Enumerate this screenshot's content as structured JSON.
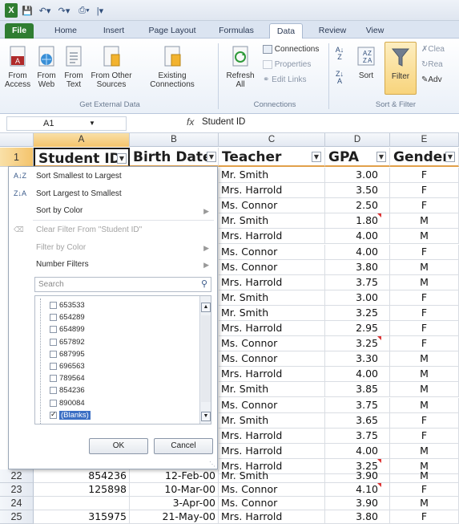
{
  "namebox": {
    "value": "A1"
  },
  "formula_bar": {
    "fx": "fx",
    "content": "Student ID"
  },
  "tabs": [
    "File",
    "Home",
    "Insert",
    "Page Layout",
    "Formulas",
    "Data",
    "Review",
    "View"
  ],
  "ribbon": {
    "from_access": "From\nAccess",
    "from_web": "From\nWeb",
    "from_text": "From\nText",
    "from_other": "From Other\nSources",
    "existing": "Existing\nConnections",
    "group_external": "Get External Data",
    "refresh": "Refresh\nAll",
    "connections": "Connections",
    "properties": "Properties",
    "edit_links": "Edit Links",
    "group_connections": "Connections",
    "sort": "Sort",
    "filter": "Filter",
    "clear": "Clea",
    "reapply": "Rea",
    "advanced": "Adv",
    "group_sort": "Sort & Filter"
  },
  "columns": [
    "A",
    "B",
    "C",
    "D",
    "E"
  ],
  "header_row": {
    "row": "1",
    "a": "Student ID",
    "b": "Birth Date",
    "c": "Teacher",
    "d": "GPA",
    "e": "Gender"
  },
  "visible_right_rows": [
    {
      "teacher": "Mr. Smith",
      "gpa": "3.00",
      "gender": "F"
    },
    {
      "teacher": "Mrs. Harrold",
      "gpa": "3.50",
      "gender": "F"
    },
    {
      "teacher": "Ms. Connor",
      "gpa": "2.50",
      "gender": "F"
    },
    {
      "teacher": "Mr. Smith",
      "gpa": "1.80",
      "gender": "M"
    },
    {
      "teacher": "Mrs. Harrold",
      "gpa": "4.00",
      "gender": "M"
    },
    {
      "teacher": "Ms. Connor",
      "gpa": "4.00",
      "gender": "F"
    },
    {
      "teacher": "Ms. Connor",
      "gpa": "3.80",
      "gender": "M"
    },
    {
      "teacher": "Mrs. Harrold",
      "gpa": "3.75",
      "gender": "M"
    },
    {
      "teacher": "Mr. Smith",
      "gpa": "3.00",
      "gender": "F"
    },
    {
      "teacher": "Mr. Smith",
      "gpa": "3.25",
      "gender": "F"
    },
    {
      "teacher": "Mrs. Harrold",
      "gpa": "2.95",
      "gender": "F"
    },
    {
      "teacher": "Ms. Connor",
      "gpa": "3.25",
      "gender": "F"
    },
    {
      "teacher": "Ms. Connor",
      "gpa": "3.30",
      "gender": "M"
    },
    {
      "teacher": "Mrs. Harrold",
      "gpa": "4.00",
      "gender": "M"
    },
    {
      "teacher": "Mr. Smith",
      "gpa": "3.85",
      "gender": "M"
    },
    {
      "teacher": "Ms. Connor",
      "gpa": "3.75",
      "gender": "M"
    },
    {
      "teacher": "Mr. Smith",
      "gpa": "3.65",
      "gender": "F"
    },
    {
      "teacher": "Mrs. Harrold",
      "gpa": "3.75",
      "gender": "F"
    },
    {
      "teacher": "Mrs. Harrold",
      "gpa": "4.00",
      "gender": "M"
    },
    {
      "teacher": "Mrs. Harrold",
      "gpa": "3.25",
      "gender": "M"
    }
  ],
  "bottom_rows": [
    {
      "row": "22",
      "id": "854236",
      "date": "12-Feb-00",
      "teacher": "Mr. Smith",
      "gpa": "3.90",
      "gender": "M"
    },
    {
      "row": "23",
      "id": "125898",
      "date": "10-Mar-00",
      "teacher": "Ms. Connor",
      "gpa": "4.10",
      "gender": "F"
    },
    {
      "row": "24",
      "id": "",
      "date": "3-Apr-00",
      "teacher": "Ms. Connor",
      "gpa": "3.90",
      "gender": "M"
    },
    {
      "row": "25",
      "id": "315975",
      "date": "21-May-00",
      "teacher": "Mrs. Harrold",
      "gpa": "3.80",
      "gender": "F"
    }
  ],
  "filter_menu": {
    "sort_asc": "Sort Smallest to Largest",
    "sort_desc": "Sort Largest to Smallest",
    "sort_color": "Sort by Color",
    "clear_filter": "Clear Filter From \"Student ID\"",
    "filter_color": "Filter by Color",
    "number_filters": "Number Filters",
    "search_placeholder": "Search",
    "items": [
      {
        "label": "653533",
        "checked": false
      },
      {
        "label": "654289",
        "checked": false
      },
      {
        "label": "654899",
        "checked": false
      },
      {
        "label": "657892",
        "checked": false
      },
      {
        "label": "687995",
        "checked": false
      },
      {
        "label": "696563",
        "checked": false
      },
      {
        "label": "789564",
        "checked": false
      },
      {
        "label": "854236",
        "checked": false
      },
      {
        "label": "890084",
        "checked": false
      },
      {
        "label": "(Blanks)",
        "checked": true
      }
    ],
    "ok": "OK",
    "cancel": "Cancel"
  },
  "colors": {
    "file_tab": "#2f7d31",
    "header_underline": "#e1a04a",
    "comment_marker": "#dd3333"
  }
}
